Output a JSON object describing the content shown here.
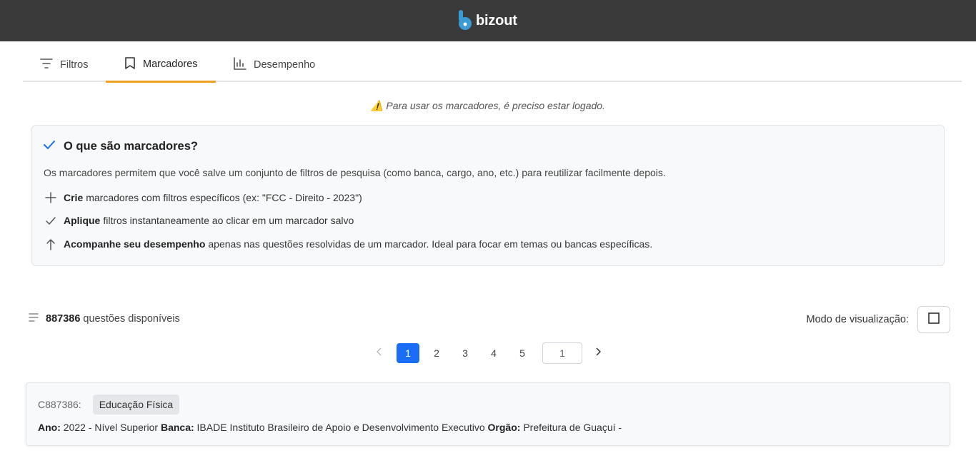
{
  "brand": {
    "name": "bizout"
  },
  "tabs": [
    {
      "label": "Filtros",
      "icon": "filter-icon"
    },
    {
      "label": "Marcadores",
      "icon": "bookmark-icon",
      "active": true
    },
    {
      "label": "Desempenho",
      "icon": "bar-chart-icon"
    }
  ],
  "warning": "⚠️ Para usar os marcadores, é preciso estar logado.",
  "info": {
    "title": "O que são marcadores?",
    "description": "Os marcadores permitem que você salve um conjunto de filtros de pesquisa (como banca, cargo, ano, etc.) para reutilizar facilmente depois.",
    "features": [
      {
        "icon": "plus-icon",
        "bold": "Crie",
        "text": "marcadores com filtros específicos (ex: \"FCC - Direito - 2023\")"
      },
      {
        "icon": "check-icon",
        "bold": "Aplique",
        "text": "filtros instantaneamente ao clicar em um marcador salvo"
      },
      {
        "icon": "arrow-up-icon",
        "bold": "Acompanhe seu desempenho",
        "text": "apenas nas questões resolvidas de um marcador. Ideal para focar em temas ou bancas específicas."
      }
    ]
  },
  "results": {
    "count": "887386",
    "label": "questões disponíveis"
  },
  "view_mode": {
    "label": "Modo de visualização:"
  },
  "pagination": {
    "pages": [
      "1",
      "2",
      "3",
      "4",
      "5"
    ],
    "current": "1",
    "input_value": "1"
  },
  "question": {
    "id": "C887386:",
    "subject": "Educação Física",
    "ano_label": "Ano:",
    "ano_value": "2022 - Nível Superior",
    "banca_label": "Banca:",
    "banca_value": "IBADE Instituto Brasileiro de Apoio e Desenvolvimento Executivo",
    "orgao_label": "Orgão:",
    "orgao_value": "Prefeitura de Guaçuí -"
  },
  "colors": {
    "topbar": "#3a3a3a",
    "accent": "#f0a020",
    "primary": "#1a6ef5",
    "brand_mark": "#3a9bd5"
  }
}
